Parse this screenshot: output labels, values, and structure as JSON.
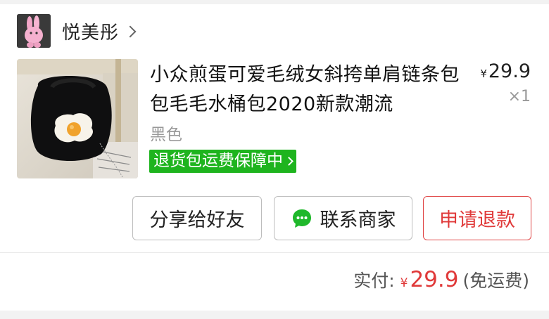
{
  "shop": {
    "name": "悦美彤",
    "avatar_icon": "pink-rabbit-avatar"
  },
  "product": {
    "title": "小众煎蛋可爱毛绒女斜挎单肩链条包包毛毛水桶包2020新款潮流",
    "price_currency": "¥",
    "price_value": "29.9",
    "quantity": "×1",
    "variant": "黑色",
    "image_icon": "black-fluffy-bag-with-fried-egg"
  },
  "badge": {
    "label": "退货包运费保障中"
  },
  "actions": {
    "share_label": "分享给好友",
    "contact_label": "联系商家",
    "refund_label": "申请退款"
  },
  "total": {
    "label": "实付:",
    "currency": "¥",
    "amount": "29.9",
    "shipping_note": "(免运费)"
  },
  "colors": {
    "accent_red": "#e03a3a",
    "badge_green": "#1eb41e",
    "wechat_green": "#1fb82b"
  }
}
